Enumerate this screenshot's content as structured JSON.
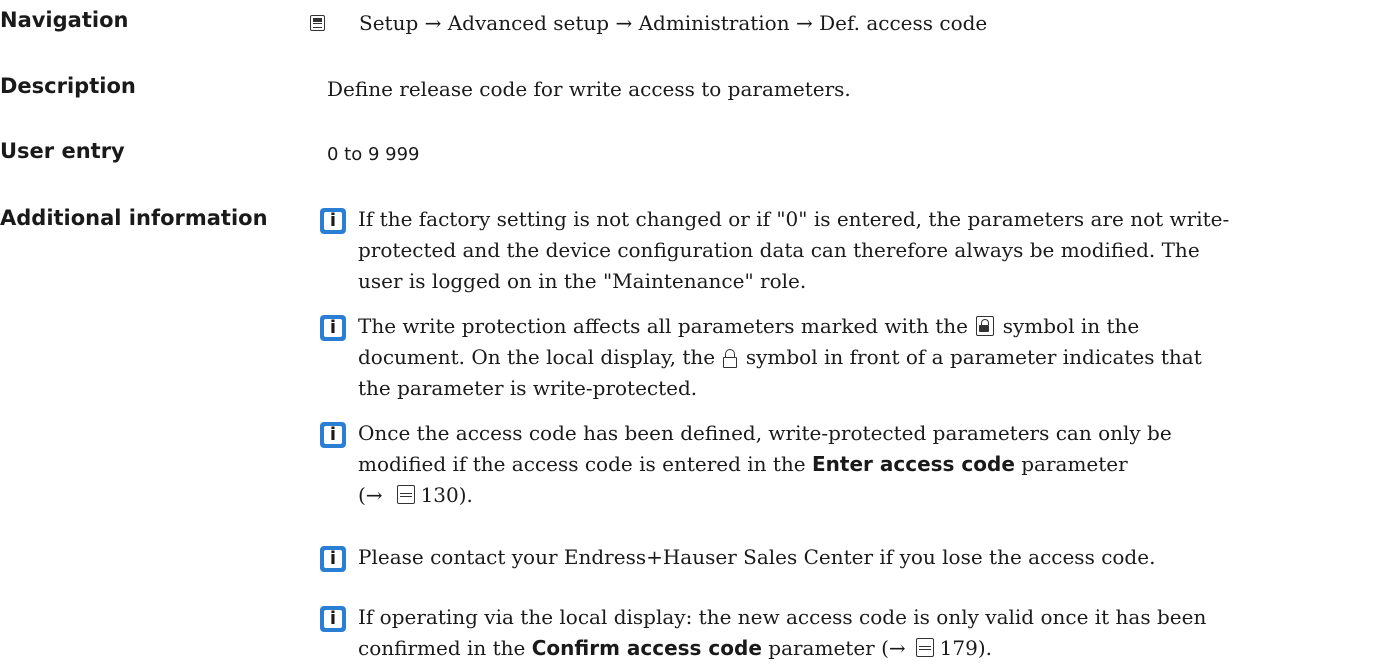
{
  "navigation": {
    "label": "Navigation",
    "path": "Setup → Advanced setup → Administration → Def. access code"
  },
  "description": {
    "label": "Description",
    "text": "Define release code for write access to parameters."
  },
  "user_entry": {
    "label": "User entry",
    "text": "0 to 9 999"
  },
  "additional_info": {
    "label": "Additional information",
    "note1": {
      "line1": "If the factory setting is not changed or if \"0\" is entered, the parameters are not write-",
      "line2": "protected and the device configuration data can therefore always be modified. The",
      "line3": "user is logged on in the \"Maintenance\" role."
    },
    "note2": {
      "part1": "The write protection affects all parameters marked with the",
      "part2": "symbol in the",
      "part3": "document. On the local display, the",
      "part4": "symbol in front of a parameter indicates that",
      "part5": "the parameter is write-protected."
    },
    "note3": {
      "line1": "Once the access code has been defined, write-protected parameters can only be",
      "line2a": "modified if the access code is entered in the",
      "line2b": "Enter access code",
      "line2c": "parameter",
      "ref_arrow": "(→",
      "ref_page": "130).",
      "page_icon": "page-ref-icon"
    },
    "note4": {
      "text": "Please contact your Endress+Hauser Sales Center if you lose the access code."
    },
    "note5": {
      "line1": "If operating via the local display: the new access code is only valid once it has been",
      "line2a": "confirmed in the",
      "line2b": "Confirm access code",
      "line2c": "parameter (→",
      "ref_page": "179).",
      "page_icon": "page-ref-icon"
    }
  }
}
